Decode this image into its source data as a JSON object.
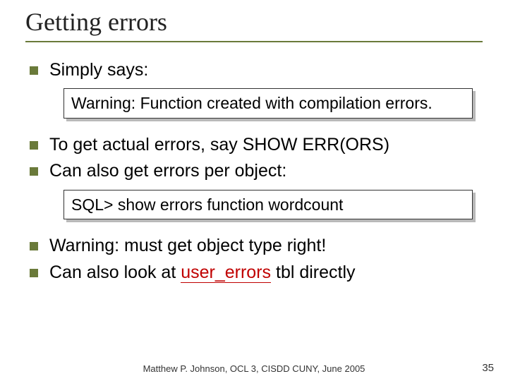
{
  "title": "Getting errors",
  "bullets": {
    "b1": "Simply says:",
    "b2": "To get actual errors, say SHOW ERR(ORS)",
    "b3": "Can also get errors per object:",
    "b4_pre": "Warning: must get object type right!",
    "b5_pre": "Can also look at ",
    "b5_hl": "user_errors",
    "b5_post": " tbl directly"
  },
  "boxes": {
    "box1": "Warning: Function created with compilation errors.",
    "box2": "SQL> show errors function wordcount"
  },
  "footer": "Matthew P. Johnson, OCL 3, CISDD CUNY, June 2005",
  "page": "35"
}
